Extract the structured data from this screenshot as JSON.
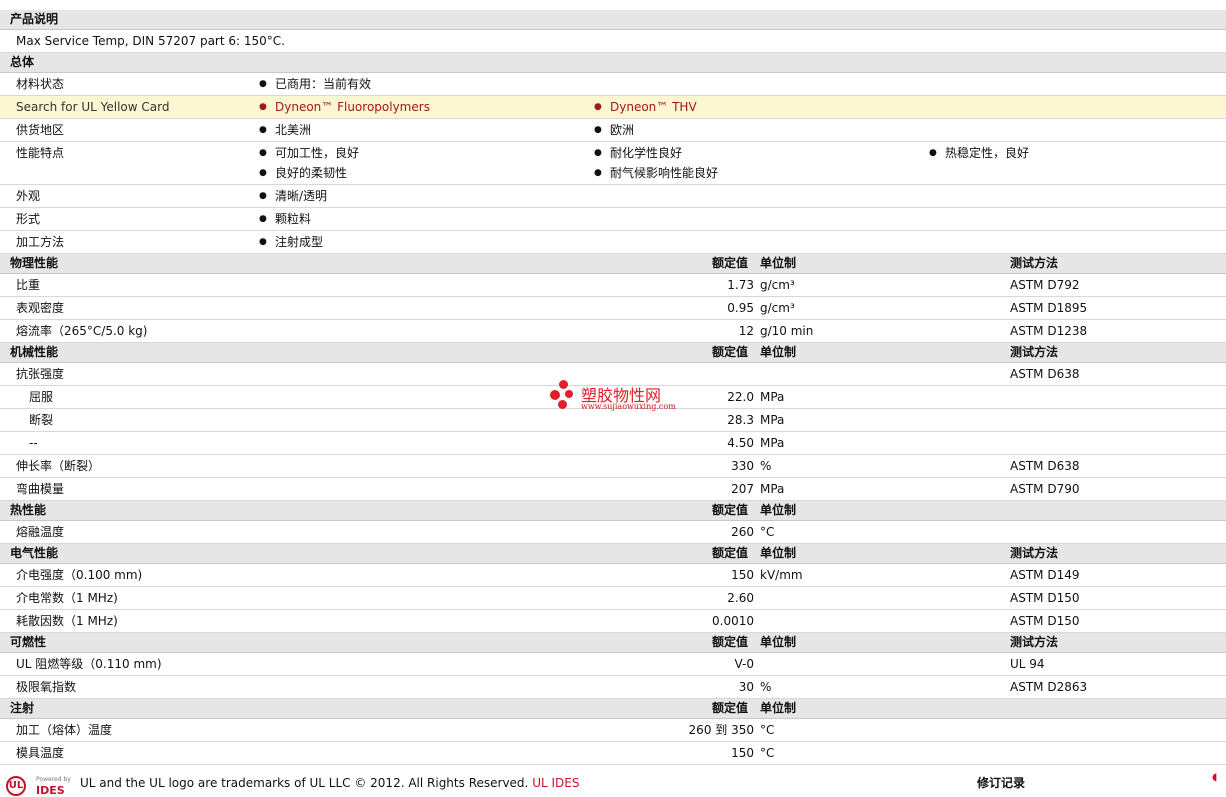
{
  "sections": {
    "desc": "产品说明",
    "general": "总体",
    "physical": "物理性能",
    "mechanical": "机械性能",
    "thermal": "热性能",
    "electrical": "电气性能",
    "flammability": "可燃性",
    "injection": "注射"
  },
  "headers": {
    "rated": "额定值",
    "unit": "单位制",
    "test": "测试方法"
  },
  "description": "Max Service Temp, DIN 57207 part 6: 150°C.",
  "general": {
    "status": {
      "label": "材料状态",
      "values": [
        "已商用：当前有效"
      ]
    },
    "ul": {
      "label": "Search for UL Yellow Card",
      "values": [
        "Dyneon™ Fluoropolymers",
        "Dyneon™ THV"
      ]
    },
    "region": {
      "label": "供货地区",
      "values": [
        "北美洲",
        "欧洲"
      ]
    },
    "features": {
      "label": "性能特点",
      "values": [
        "可加工性，良好",
        "耐化学性良好",
        "热稳定性，良好",
        "良好的柔韧性",
        "耐气候影响性能良好"
      ]
    },
    "appearance": {
      "label": "外观",
      "values": [
        "清晰/透明"
      ]
    },
    "form": {
      "label": "形式",
      "values": [
        "颗粒料"
      ]
    },
    "method": {
      "label": "加工方法",
      "values": [
        "注射成型"
      ]
    }
  },
  "physical": [
    {
      "label": "比重",
      "value": "1.73",
      "unit": "g/cm³",
      "test": "ASTM D792"
    },
    {
      "label": "表观密度",
      "value": "0.95",
      "unit": "g/cm³",
      "test": "ASTM D1895"
    },
    {
      "label": "熔流率（265°C/5.0 kg)",
      "value": "12",
      "unit": "g/10 min",
      "test": "ASTM D1238"
    }
  ],
  "mechanical": {
    "tensile": {
      "label": "抗张强度",
      "test": "ASTM D638"
    },
    "yield": {
      "label": "屈服",
      "value": "22.0",
      "unit": "MPa"
    },
    "break": {
      "label": "断裂",
      "value": "28.3",
      "unit": "MPa"
    },
    "dash": {
      "label": "--",
      "value": "4.50",
      "unit": "MPa"
    },
    "elong": {
      "label": "伸长率（断裂）",
      "value": "330",
      "unit": "%",
      "test": "ASTM D638"
    },
    "flex": {
      "label": "弯曲模量",
      "value": "207",
      "unit": "MPa",
      "test": "ASTM D790"
    }
  },
  "thermal": [
    {
      "label": "熔融温度",
      "value": "260",
      "unit": "°C"
    }
  ],
  "electrical": [
    {
      "label": "介电强度（0.100 mm)",
      "value": "150",
      "unit": "kV/mm",
      "test": "ASTM D149"
    },
    {
      "label": "介电常数（1 MHz)",
      "value": "2.60",
      "unit": "",
      "test": "ASTM D150"
    },
    {
      "label": "耗散因数（1 MHz)",
      "value": "0.0010",
      "unit": "",
      "test": "ASTM D150"
    }
  ],
  "flammability": [
    {
      "label": "UL 阻燃等级（0.110 mm)",
      "value": "V-0",
      "unit": "",
      "test": "UL 94"
    },
    {
      "label": "极限氧指数",
      "value": "30",
      "unit": "%",
      "test": "ASTM D2863"
    }
  ],
  "injection": [
    {
      "label": "加工（熔体）温度",
      "value": "260 到  350",
      "unit": "°C"
    },
    {
      "label": "模具温度",
      "value": "150",
      "unit": "°C"
    }
  ],
  "watermark": {
    "name": "塑胶物性网",
    "url": "www.sujiaowuxing.com"
  },
  "footer": {
    "powered": "Powered by",
    "ides": "IDES",
    "logo": "UL",
    "text": "UL and the UL logo are trademarks of UL LLC © 2012. All Rights Reserved.",
    "link": "UL IDES",
    "revision": "修订记录"
  }
}
